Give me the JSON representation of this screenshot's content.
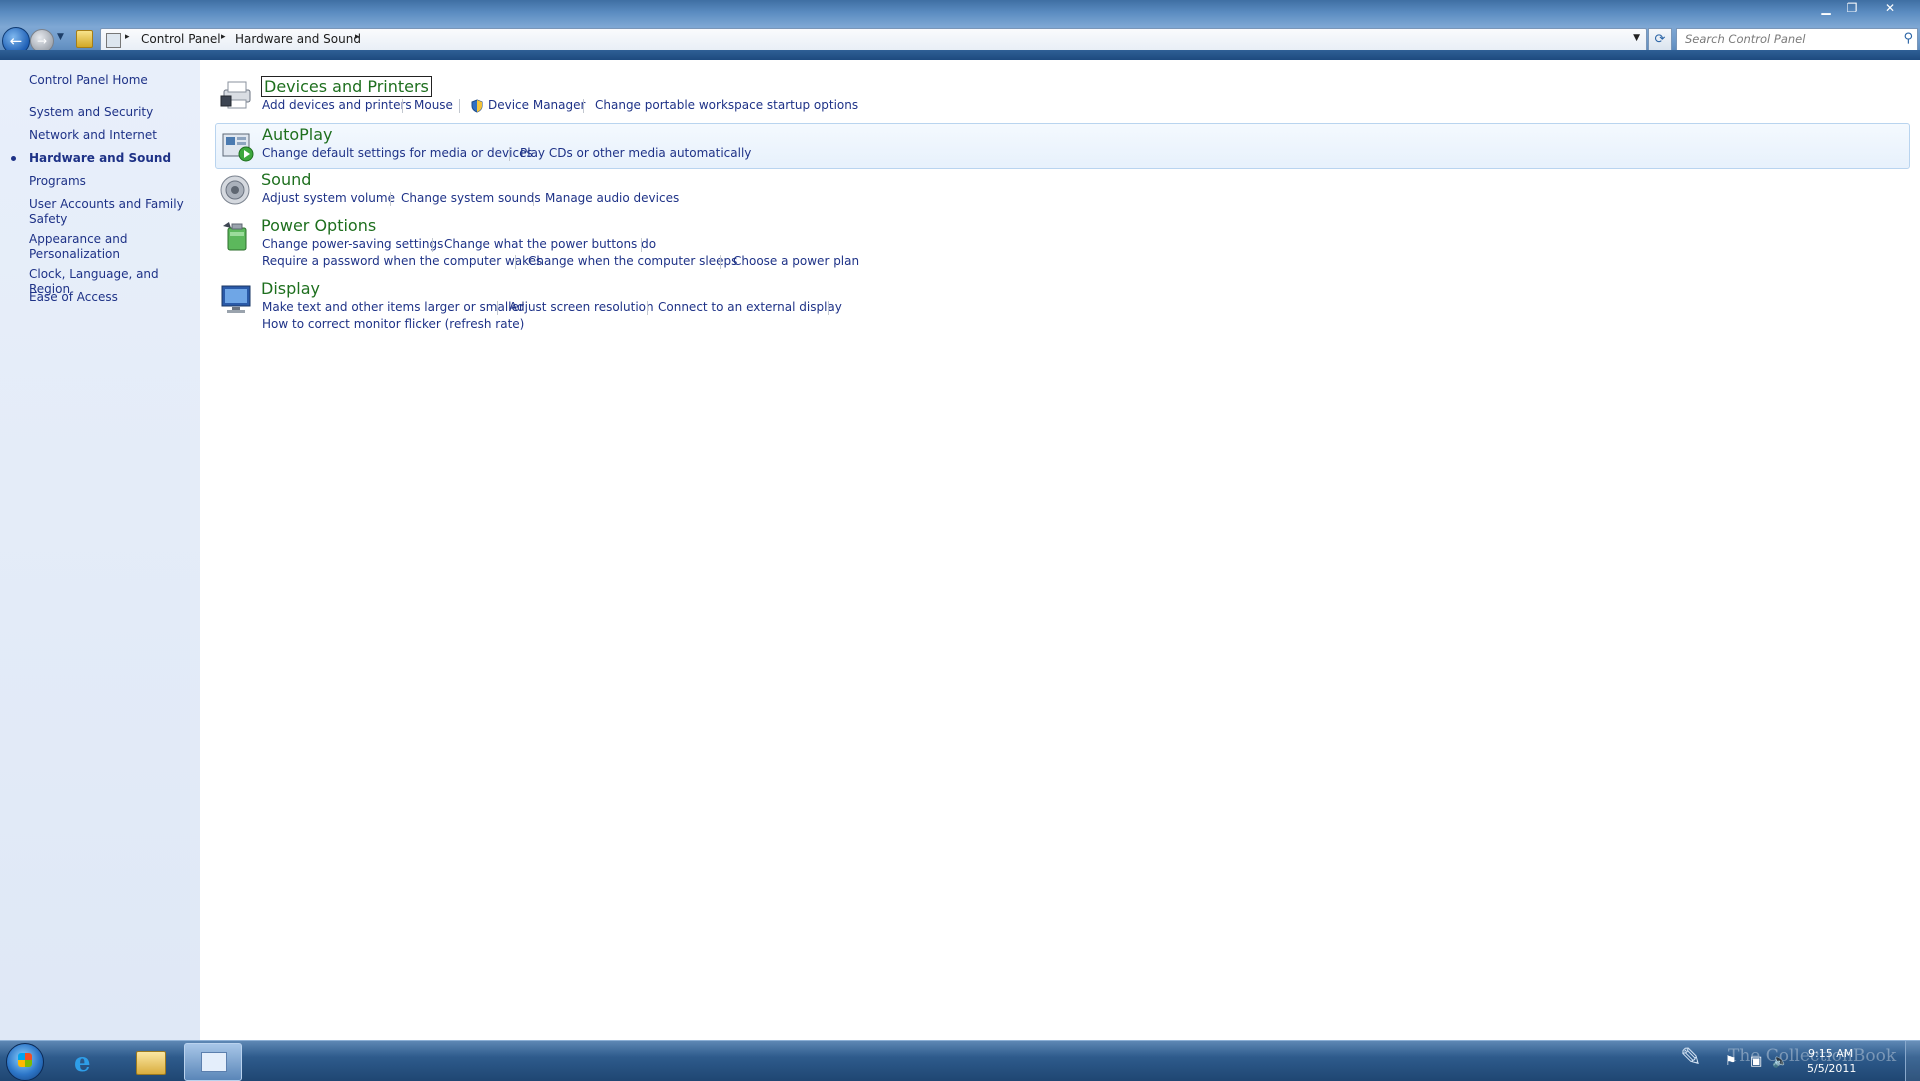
{
  "window": {
    "minimize_glyph": "▁",
    "maximize_glyph": "❐",
    "close_glyph": "✕"
  },
  "nav": {
    "back_glyph": "←",
    "forward_glyph": "→",
    "history_glyph": "▼",
    "breadcrumb": [
      "Control Panel",
      "Hardware and Sound"
    ],
    "breadcrumb_sep": "▸",
    "address_drop_glyph": "▼",
    "refresh_glyph": "⟳"
  },
  "search": {
    "placeholder": "Search Control Panel",
    "icon_glyph": "⚲"
  },
  "sidebar": {
    "items": [
      {
        "label": "Control Panel Home"
      },
      {
        "label": "System and Security"
      },
      {
        "label": "Network and Internet"
      },
      {
        "label": "Hardware and Sound",
        "active": true
      },
      {
        "label": "Programs"
      },
      {
        "label": "User Accounts and Family Safety"
      },
      {
        "label": "Appearance and Personalization"
      },
      {
        "label": "Clock, Language, and Region"
      },
      {
        "label": "Ease of Access"
      }
    ]
  },
  "categories": {
    "devices": {
      "title": "Devices and Printers",
      "links": [
        "Add devices and printers",
        "Mouse",
        "Device Manager",
        "Change portable workspace startup options"
      ]
    },
    "autoplay": {
      "title": "AutoPlay",
      "links": [
        "Change default settings for media or devices",
        "Play CDs or other media automatically"
      ]
    },
    "sound": {
      "title": "Sound",
      "links": [
        "Adjust system volume",
        "Change system sounds",
        "Manage audio devices"
      ]
    },
    "power": {
      "title": "Power Options",
      "links": [
        "Change power-saving settings",
        "Change what the power buttons do",
        "Require a password when the computer wakes",
        "Change when the computer sleeps",
        "Choose a power plan"
      ]
    },
    "display": {
      "title": "Display",
      "links": [
        "Make text and other items larger or smaller",
        "Adjust screen resolution",
        "Connect to an external display",
        "How to correct monitor flicker (refresh rate)"
      ]
    }
  },
  "taskbar": {
    "ie_glyph": "e",
    "watermark": "The CollectionBook",
    "time": "9:15 AM",
    "date": "5/5/2011",
    "tray": {
      "flag_glyph": "⚑",
      "network_glyph": "▣",
      "volume_glyph": "🔈"
    }
  },
  "colors": {
    "link": "#1e3287",
    "category_title": "#1e6f1e",
    "sidebar_bg": "#e4ecf8"
  }
}
